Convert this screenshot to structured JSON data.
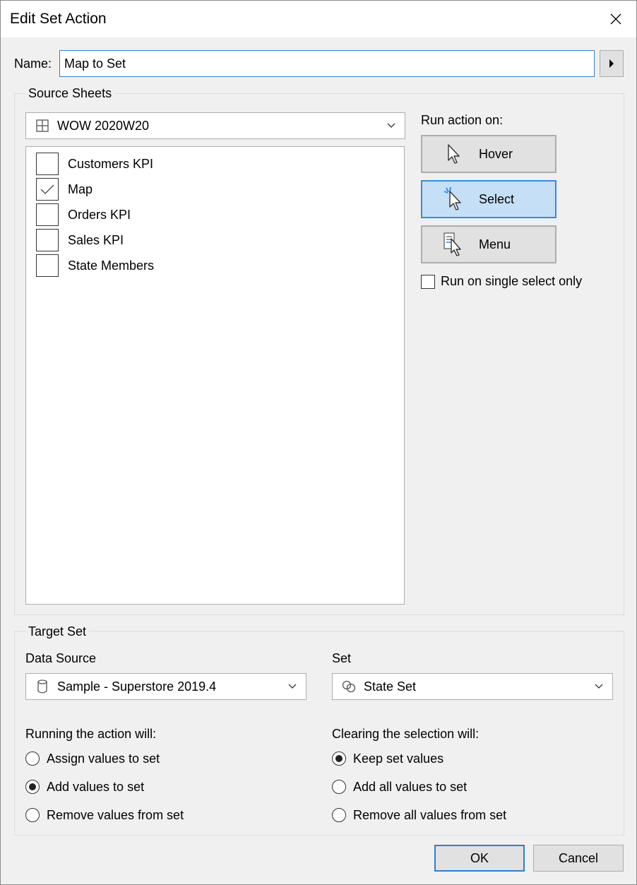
{
  "window": {
    "title": "Edit Set Action"
  },
  "name": {
    "label": "Name:",
    "value": "Map to Set"
  },
  "source_sheets": {
    "caption": "Source Sheets",
    "dashboard": {
      "value": "WOW 2020W20",
      "icon": "dashboard-grid-icon"
    },
    "sheets": [
      {
        "label": "Customers KPI",
        "checked": false
      },
      {
        "label": "Map",
        "checked": true
      },
      {
        "label": "Orders KPI",
        "checked": false
      },
      {
        "label": "Sales KPI",
        "checked": false
      },
      {
        "label": "State Members",
        "checked": false
      }
    ],
    "run_action_on": {
      "label": "Run action on:",
      "options": [
        {
          "label": "Hover",
          "icon": "hover-cursor-icon",
          "selected": false
        },
        {
          "label": "Select",
          "icon": "select-cursor-icon",
          "selected": true
        },
        {
          "label": "Menu",
          "icon": "menu-cursor-icon",
          "selected": false
        }
      ],
      "single_select_only": {
        "label": "Run on single select only",
        "checked": false
      }
    }
  },
  "target_set": {
    "caption": "Target Set",
    "data_source": {
      "label": "Data Source",
      "value": "Sample - Superstore 2019.4",
      "icon": "database-icon"
    },
    "set": {
      "label": "Set",
      "value": "State Set",
      "icon": "set-icon"
    },
    "running_action": {
      "label": "Running the action will:",
      "options": [
        {
          "label": "Assign values to set",
          "selected": false
        },
        {
          "label": "Add values to set",
          "selected": true
        },
        {
          "label": "Remove values from set",
          "selected": false
        }
      ]
    },
    "clearing_selection": {
      "label": "Clearing the selection will:",
      "options": [
        {
          "label": "Keep set values",
          "selected": true
        },
        {
          "label": "Add all values to set",
          "selected": false
        },
        {
          "label": "Remove all values from set",
          "selected": false
        }
      ]
    }
  },
  "buttons": {
    "ok": "OK",
    "cancel": "Cancel"
  },
  "colors": {
    "accent": "#2f7fd0",
    "selected_bg": "#c5e0f6",
    "button_bg": "#e1e1e1",
    "dialog_bg": "#f0f0f0"
  }
}
